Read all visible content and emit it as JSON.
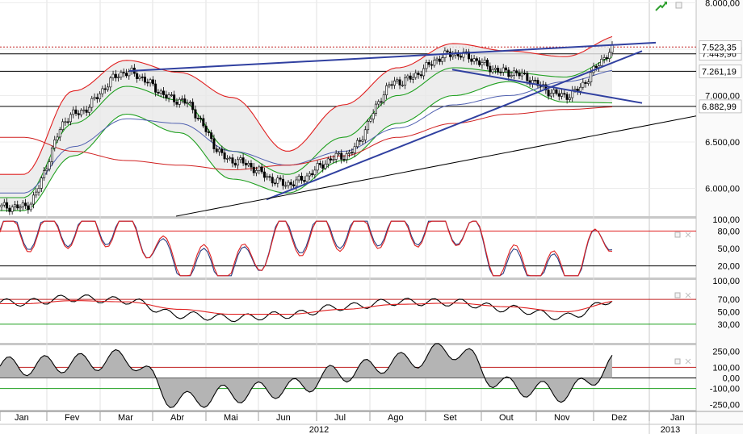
{
  "chart_data": {
    "type": "candlestick",
    "xlabel": "",
    "x_axis": {
      "months": [
        "Jan",
        "Fev",
        "Mar",
        "Abr",
        "Mai",
        "Jun",
        "Jul",
        "Ago",
        "Set",
        "Out",
        "Nov",
        "Dez",
        "Jan"
      ],
      "years": [
        "2012",
        "2013"
      ]
    },
    "price_panel": {
      "yticks": [
        "6.000,00",
        "6.500,00",
        "7.000,00",
        "7.500,00",
        "8.000,00"
      ],
      "ylim": [
        5700,
        8030
      ],
      "last_value_label": "7.523,35",
      "level_labels": [
        "7.449,96",
        "7.261,19",
        "6.882,99"
      ],
      "horizontal_levels": [
        7449.96,
        7261.19,
        6882.99
      ],
      "series": [
        {
          "name": "close",
          "color": "#000000",
          "keys": [
            [
              "Jan",
              5800
            ],
            [
              "Fev",
              6800
            ],
            [
              "Mar",
              7250
            ],
            [
              "Abr",
              6950
            ],
            [
              "Mai",
              6300
            ],
            [
              "Jun",
              6050
            ],
            [
              "Jul",
              6350
            ],
            [
              "Ago",
              7150
            ],
            [
              "Set",
              7450
            ],
            [
              "Out",
              7250
            ],
            [
              "Nov",
              7000
            ],
            [
              "Dez",
              7523
            ]
          ]
        },
        {
          "name": "bollinger_upper",
          "color": "#e02020",
          "keys": [
            [
              "Jan",
              6150
            ],
            [
              "Fev",
              7050
            ],
            [
              "Mar",
              7380
            ],
            [
              "Abr",
              7250
            ],
            [
              "Mai",
              6980
            ],
            [
              "Jun",
              6400
            ],
            [
              "Jul",
              6900
            ],
            [
              "Ago",
              7300
            ],
            [
              "Set",
              7560
            ],
            [
              "Out",
              7480
            ],
            [
              "Nov",
              7420
            ],
            [
              "Dez",
              7650
            ]
          ]
        },
        {
          "name": "bollinger_middle",
          "color": "#20a020",
          "keys": [
            [
              "Jan",
              5900
            ],
            [
              "Fev",
              6700
            ],
            [
              "Mar",
              7100
            ],
            [
              "Abr",
              6950
            ],
            [
              "Mai",
              6400
            ],
            [
              "Jun",
              6150
            ],
            [
              "Jul",
              6550
            ],
            [
              "Ago",
              7000
            ],
            [
              "Set",
              7300
            ],
            [
              "Out",
              7250
            ],
            [
              "Nov",
              7200
            ],
            [
              "Dez",
              7430
            ]
          ]
        },
        {
          "name": "bollinger_lower",
          "color": "#20a020",
          "keys": [
            [
              "Jan",
              5760
            ],
            [
              "Fev",
              6350
            ],
            [
              "Mar",
              6800
            ],
            [
              "Abr",
              6600
            ],
            [
              "Mai",
              6100
            ],
            [
              "Jun",
              5950
            ],
            [
              "Jul",
              6300
            ],
            [
              "Ago",
              6700
            ],
            [
              "Set",
              7000
            ],
            [
              "Out",
              7150
            ],
            [
              "Nov",
              6930
            ],
            [
              "Dez",
              6920
            ]
          ]
        },
        {
          "name": "moving_average_mid",
          "color": "#5060b0",
          "keys": [
            [
              "Jan",
              5950
            ],
            [
              "Fev",
              6450
            ],
            [
              "Mar",
              6750
            ],
            [
              "Abr",
              6700
            ],
            [
              "Mai",
              6400
            ],
            [
              "Jun",
              6250
            ],
            [
              "Jul",
              6400
            ],
            [
              "Ago",
              6650
            ],
            [
              "Set",
              6900
            ],
            [
              "Out",
              7000
            ],
            [
              "Nov",
              7150
            ],
            [
              "Dez",
              7280
            ]
          ]
        },
        {
          "name": "moving_average_long",
          "color": "#d02020",
          "keys": [
            [
              "Jan",
              6550
            ],
            [
              "Fev",
              6400
            ],
            [
              "Mar",
              6300
            ],
            [
              "Abr",
              6250
            ],
            [
              "Mai",
              6200
            ],
            [
              "Jun",
              6250
            ],
            [
              "Jul",
              6350
            ],
            [
              "Ago",
              6550
            ],
            [
              "Set",
              6700
            ],
            [
              "Out",
              6800
            ],
            [
              "Nov",
              6850
            ],
            [
              "Dez",
              6880
            ]
          ]
        }
      ],
      "trend_lines": [
        {
          "color": "#3040a0",
          "from": [
            "Mar",
            7265
          ],
          "to": [
            "Dez",
            7570
          ]
        },
        {
          "color": "#3040a0",
          "from": [
            "Jun",
            5880
          ],
          "to": [
            "Dez",
            7480
          ]
        },
        {
          "color": "#3040a0",
          "from": [
            "Set",
            7280
          ],
          "to": [
            "Dez",
            6920
          ]
        },
        {
          "color": "#000000",
          "from": [
            "Abr",
            5700
          ],
          "to": [
            "Jan",
            6780
          ]
        }
      ]
    },
    "stochastic_panel": {
      "yticks": [
        "20,00",
        "50,00",
        "80,00",
        "100,00"
      ],
      "ylim": [
        0,
        100
      ],
      "levels": [
        20,
        80
      ],
      "series": [
        {
          "name": "stochastic_k",
          "color": "#2a3d80",
          "keys": [
            [
              "Jan",
              82
            ],
            [
              "Fev",
              88
            ],
            [
              "Mar",
              92
            ],
            [
              "Abr",
              18
            ],
            [
              "Mai",
              12
            ],
            [
              "Jun",
              75
            ],
            [
              "Jul",
              85
            ],
            [
              "Ago",
              90
            ],
            [
              "Set",
              92
            ],
            [
              "Out",
              15
            ],
            [
              "Nov",
              5
            ],
            [
              "Dez",
              88
            ]
          ]
        },
        {
          "name": "stochastic_d",
          "color": "#e02020",
          "keys": [
            [
              "Jan",
              78
            ],
            [
              "Fev",
              85
            ],
            [
              "Mar",
              88
            ],
            [
              "Abr",
              25
            ],
            [
              "Mai",
              18
            ],
            [
              "Jun",
              70
            ],
            [
              "Jul",
              80
            ],
            [
              "Ago",
              86
            ],
            [
              "Set",
              90
            ],
            [
              "Out",
              22
            ],
            [
              "Nov",
              10
            ],
            [
              "Dez",
              85
            ]
          ]
        }
      ]
    },
    "rsi_panel": {
      "yticks": [
        "30,00",
        "50,00",
        "70,00",
        "100,00"
      ],
      "ylim": [
        0,
        100
      ],
      "levels": [
        30,
        70
      ],
      "series": [
        {
          "name": "rsi",
          "color": "#000000",
          "keys": [
            [
              "Jan",
              65
            ],
            [
              "Fev",
              72
            ],
            [
              "Mar",
              68
            ],
            [
              "Abr",
              45
            ],
            [
              "Mai",
              40
            ],
            [
              "Jun",
              45
            ],
            [
              "Jul",
              58
            ],
            [
              "Ago",
              66
            ],
            [
              "Set",
              65
            ],
            [
              "Out",
              55
            ],
            [
              "Nov",
              42
            ],
            [
              "Dez",
              72
            ]
          ]
        },
        {
          "name": "rsi_average",
          "color": "#e02020",
          "keys": [
            [
              "Jan",
              63
            ],
            [
              "Fev",
              68
            ],
            [
              "Mar",
              66
            ],
            [
              "Abr",
              54
            ],
            [
              "Mai",
              46
            ],
            [
              "Jun",
              46
            ],
            [
              "Jul",
              54
            ],
            [
              "Ago",
              62
            ],
            [
              "Set",
              64
            ],
            [
              "Out",
              58
            ],
            [
              "Nov",
              50
            ],
            [
              "Dez",
              68
            ]
          ]
        }
      ]
    },
    "cci_panel": {
      "yticks": [
        "-250,00",
        "-100,00",
        "0,00",
        "100,00",
        "250,00"
      ],
      "ylim": [
        -300,
        300
      ],
      "levels": [
        -100,
        0,
        100
      ],
      "series": [
        {
          "name": "cci",
          "color": "#000000",
          "keys": [
            [
              "Jan",
              110
            ],
            [
              "Fev",
              140
            ],
            [
              "Mar",
              180
            ],
            [
              "Abr",
              -220
            ],
            [
              "Mai",
              -150
            ],
            [
              "Jun",
              -100
            ],
            [
              "Jul",
              50
            ],
            [
              "Ago",
              150
            ],
            [
              "Set",
              260
            ],
            [
              "Out",
              -80
            ],
            [
              "Nov",
              -140
            ],
            [
              "Dez",
              150
            ]
          ]
        }
      ]
    }
  }
}
